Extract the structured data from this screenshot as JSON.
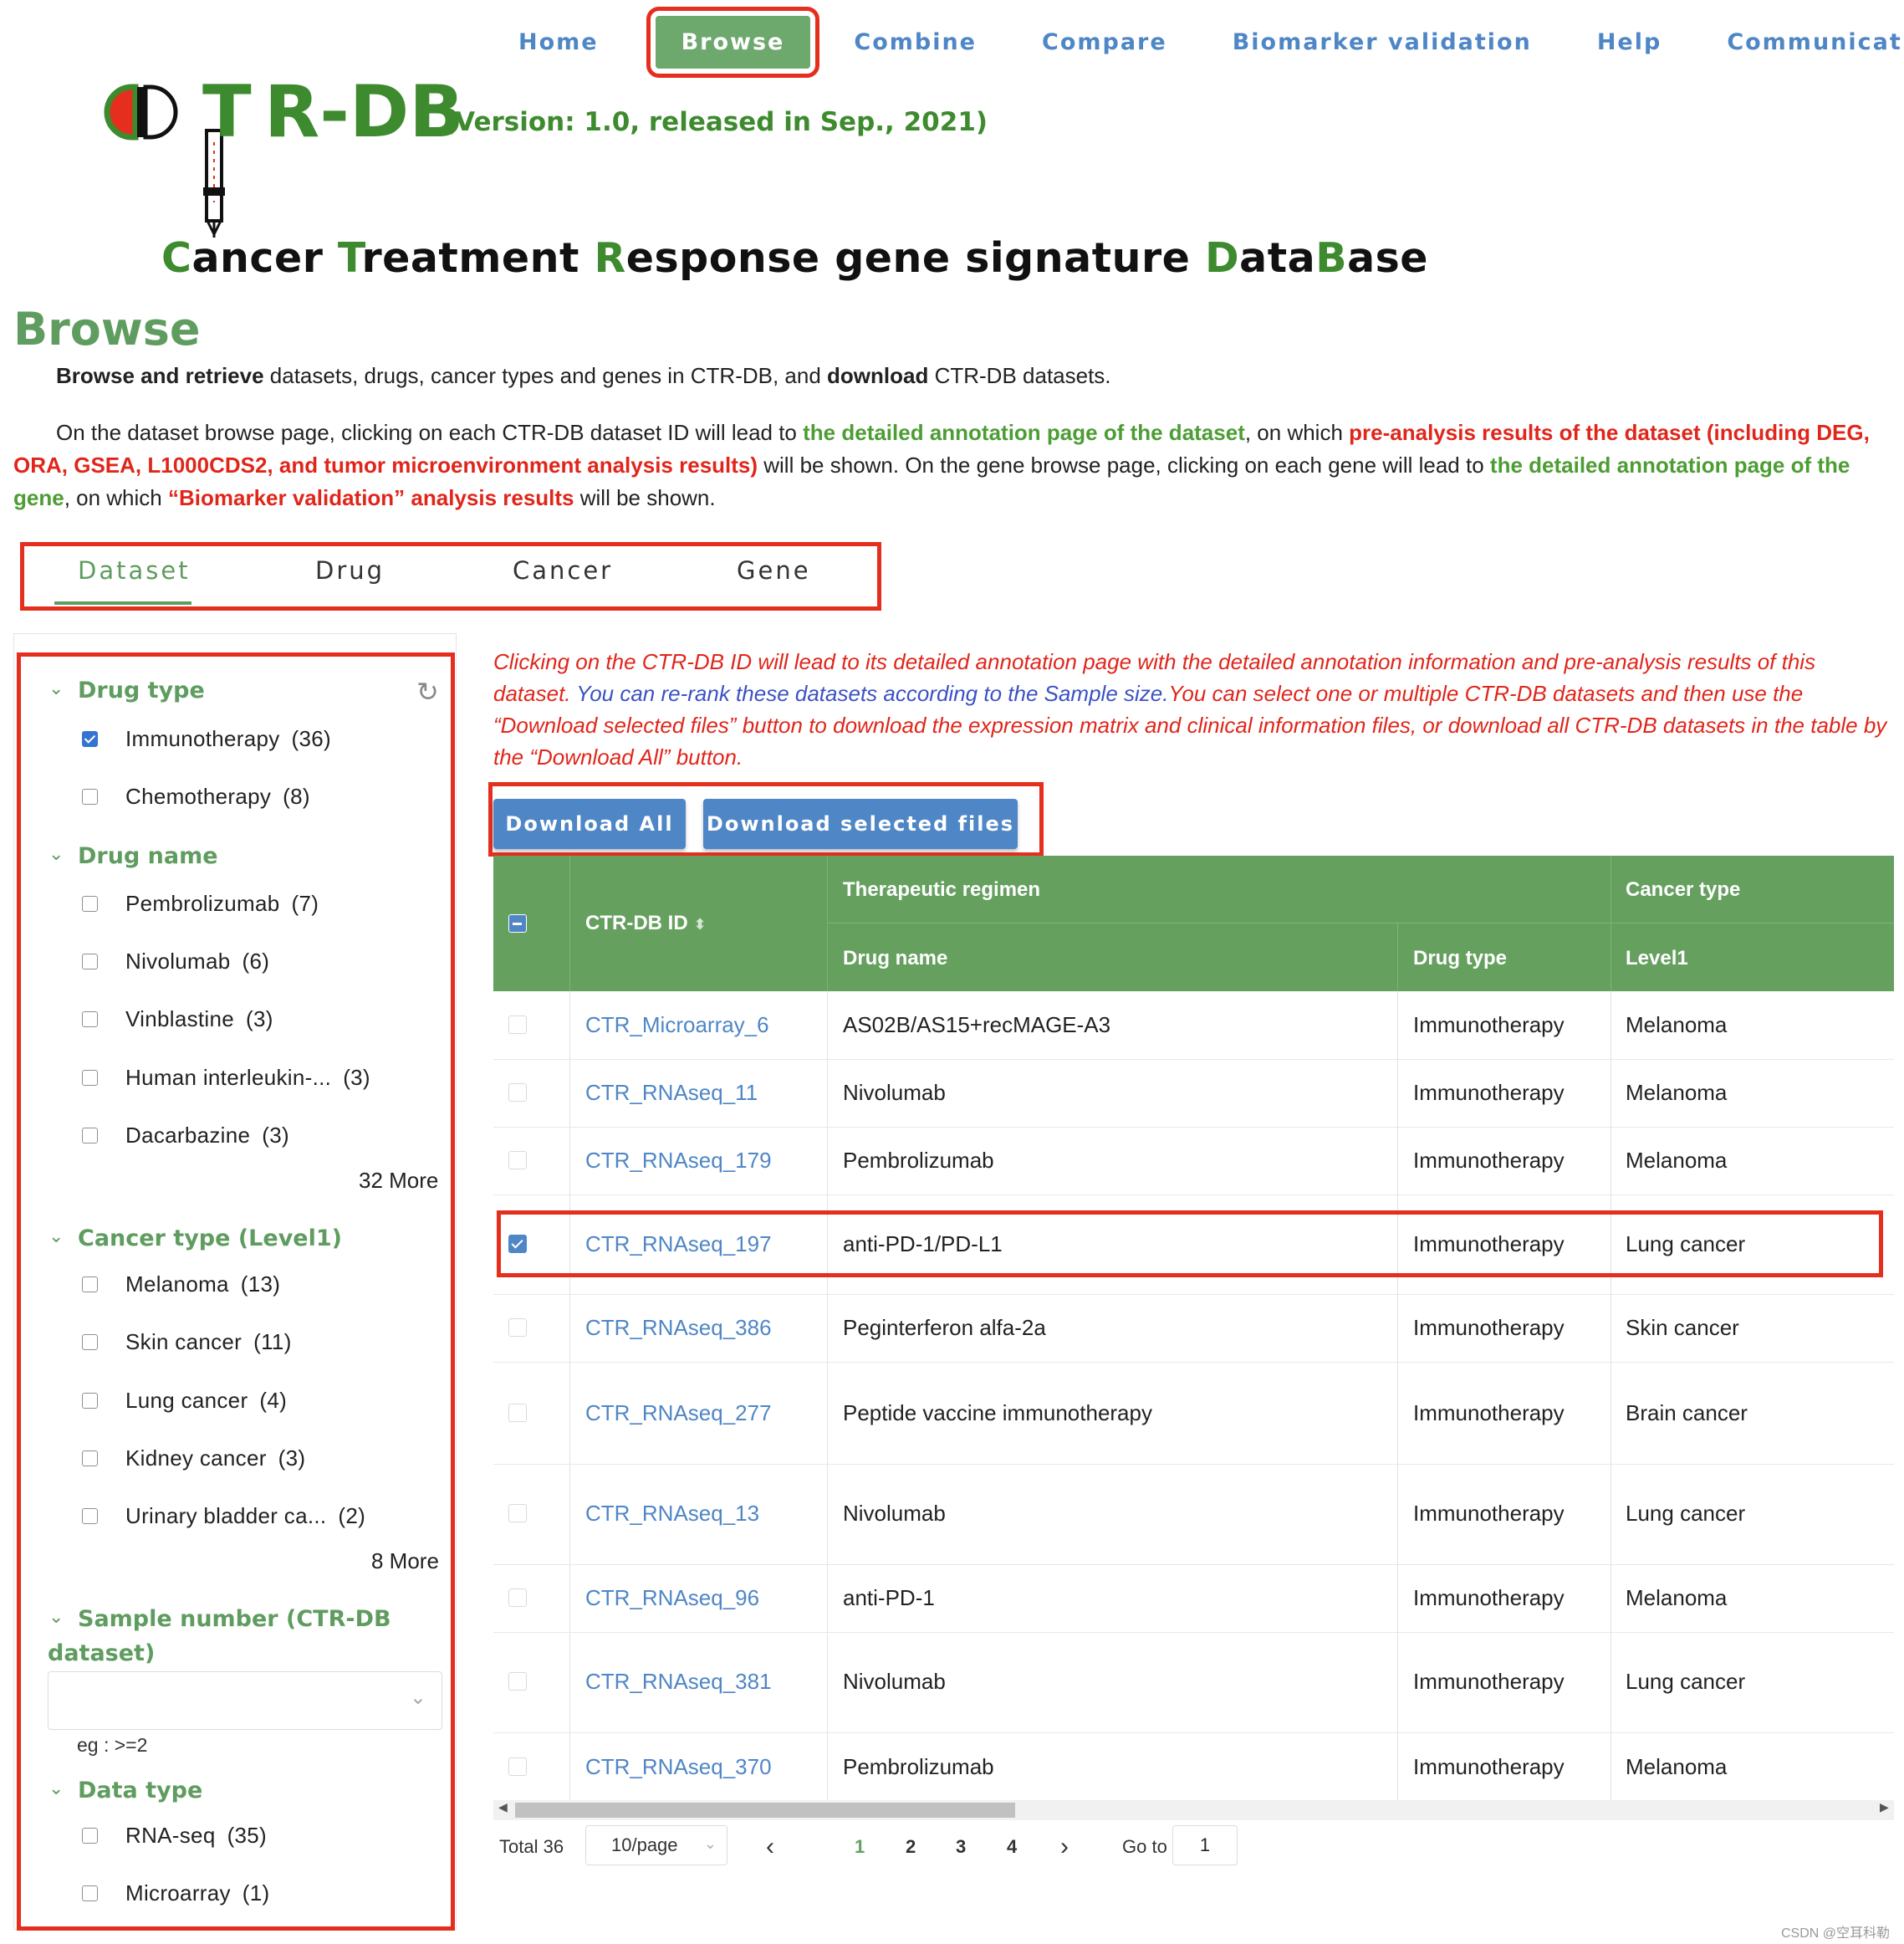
{
  "nav": {
    "items": [
      {
        "label": "Home"
      },
      {
        "label": "Browse"
      },
      {
        "label": "Combine"
      },
      {
        "label": "Compare"
      },
      {
        "label": "Biomarker validation"
      },
      {
        "label": "Help"
      },
      {
        "label": "Communication"
      }
    ],
    "active": "Browse"
  },
  "header": {
    "logo_text": "R-DB",
    "logo_letters": "T",
    "version": "(Version: 1.0, released in Sep., 2021)",
    "subtitle_parts": [
      "C",
      "ancer ",
      "T",
      "reatment ",
      "R",
      "esponse gene signature ",
      "D",
      "ata",
      "B",
      "ase"
    ]
  },
  "page": {
    "title": "Browse",
    "intro1_bold1": "Browse and retrieve",
    "intro1_text1": " datasets, drugs, cancer types and genes in CTR-DB, and ",
    "intro1_bold2": "download",
    "intro1_text2": " CTR-DB datasets.",
    "intro2_t1": "On the dataset browse page, clicking on each CTR-DB dataset ID will lead to ",
    "intro2_g1": "the detailed annotation page of the dataset",
    "intro2_t2": ", on which ",
    "intro2_r1": "pre-analysis results of the dataset (including DEG, ORA, GSEA, L1000CDS2, and tumor microenvironment analysis results)",
    "intro2_t3": " will be shown. On the gene browse page, clicking on each gene will lead to ",
    "intro2_g2": "the detailed annotation page of the gene",
    "intro2_t4": ", on which ",
    "intro2_r2": "“Biomarker validation” analysis results",
    "intro2_t5": " will be shown."
  },
  "tabs": [
    {
      "label": "Dataset",
      "active": true
    },
    {
      "label": "Drug",
      "active": false
    },
    {
      "label": "Cancer",
      "active": false
    },
    {
      "label": "Gene",
      "active": false
    }
  ],
  "sidebar": {
    "drug_type": {
      "title": "Drug type",
      "items": [
        {
          "label": "Immunotherapy",
          "count": "(36)",
          "checked": true
        },
        {
          "label": "Chemotherapy",
          "count": "(8)",
          "checked": false
        }
      ]
    },
    "drug_name": {
      "title": "Drug name",
      "items": [
        {
          "label": "Pembrolizumab",
          "count": "(7)"
        },
        {
          "label": "Nivolumab",
          "count": "(6)"
        },
        {
          "label": "Vinblastine",
          "count": "(3)"
        },
        {
          "label": "Human interleukin-...",
          "count": "(3)"
        },
        {
          "label": "Dacarbazine",
          "count": "(3)"
        }
      ],
      "more": "32 More"
    },
    "cancer_type": {
      "title": "Cancer type (Level1)",
      "items": [
        {
          "label": "Melanoma",
          "count": "(13)"
        },
        {
          "label": "Skin cancer",
          "count": "(11)"
        },
        {
          "label": "Lung cancer",
          "count": "(4)"
        },
        {
          "label": "Kidney cancer",
          "count": "(3)"
        },
        {
          "label": "Urinary bladder ca...",
          "count": "(2)"
        }
      ],
      "more": "8 More"
    },
    "sample_number": {
      "title_line1": "Sample number (CTR-DB",
      "title_line2": "dataset)",
      "value": "",
      "hint": "eg : >=2"
    },
    "data_type": {
      "title": "Data type",
      "items": [
        {
          "label": "RNA-seq",
          "count": "(35)"
        },
        {
          "label": "Microarray",
          "count": "(1)"
        }
      ]
    }
  },
  "notice": {
    "red1": "Clicking on the CTR-DB ID will lead to its detailed annotation page with the detailed annotation information and pre-analysis results of this dataset.",
    "blue": "You can re-rank these datasets according to the Sample size.",
    "red2": "You can select one or multiple CTR-DB datasets and then use the “Download selected files” button to download the expression matrix and clinical information files, or download all CTR-DB datasets in the table by the “Download All” button."
  },
  "buttons": {
    "download_all": "Download All",
    "download_selected": "Download selected files"
  },
  "table": {
    "headers": {
      "id": "CTR-DB ID",
      "regimen": "Therapeutic regimen",
      "cancer_type": "Cancer type",
      "drug_name": "Drug name",
      "drug_type": "Drug type",
      "level1": "Level1"
    },
    "rows": [
      {
        "id": "CTR_Microarray_6",
        "drug": "AS02B/AS15+recMAGE-A3",
        "type": "Immunotherapy",
        "cancer": "Melanoma",
        "checked": false
      },
      {
        "id": "CTR_RNAseq_11",
        "drug": "Nivolumab",
        "type": "Immunotherapy",
        "cancer": "Melanoma",
        "checked": false
      },
      {
        "id": "CTR_RNAseq_179",
        "drug": "Pembrolizumab",
        "type": "Immunotherapy",
        "cancer": "Melanoma",
        "checked": false
      },
      {
        "id": "CTR_RNAseq_197",
        "drug": "anti-PD-1/PD-L1",
        "type": "Immunotherapy",
        "cancer": "Lung cancer",
        "checked": true
      },
      {
        "id": "CTR_RNAseq_386",
        "drug": "Peginterferon alfa-2a",
        "type": "Immunotherapy",
        "cancer": "Skin cancer",
        "checked": false
      },
      {
        "id": "CTR_RNAseq_277",
        "drug": "Peptide vaccine immunotherapy",
        "type": "Immunotherapy",
        "cancer": "Brain cancer",
        "checked": false
      },
      {
        "id": "CTR_RNAseq_13",
        "drug": "Nivolumab",
        "type": "Immunotherapy",
        "cancer": "Lung cancer",
        "checked": false
      },
      {
        "id": "CTR_RNAseq_96",
        "drug": "anti-PD-1",
        "type": "Immunotherapy",
        "cancer": "Melanoma",
        "checked": false
      },
      {
        "id": "CTR_RNAseq_381",
        "drug": "Nivolumab",
        "type": "Immunotherapy",
        "cancer": "Lung cancer",
        "checked": false
      },
      {
        "id": "CTR_RNAseq_370",
        "drug": "Pembrolizumab",
        "type": "Immunotherapy",
        "cancer": "Melanoma",
        "checked": false
      }
    ]
  },
  "pagination": {
    "total": "Total 36",
    "page_size": "10/page",
    "prev": "‹",
    "next": "›",
    "pages": [
      "1",
      "2",
      "3",
      "4"
    ],
    "current": "1",
    "goto_label": "Go to",
    "goto_value": "1"
  },
  "watermark": "CSDN @空耳科勒",
  "colors": {
    "brand_green": "#3d8b2e",
    "header_green": "#65a05f",
    "link_blue": "#4f86c6",
    "highlight_red": "#e62e1e"
  }
}
